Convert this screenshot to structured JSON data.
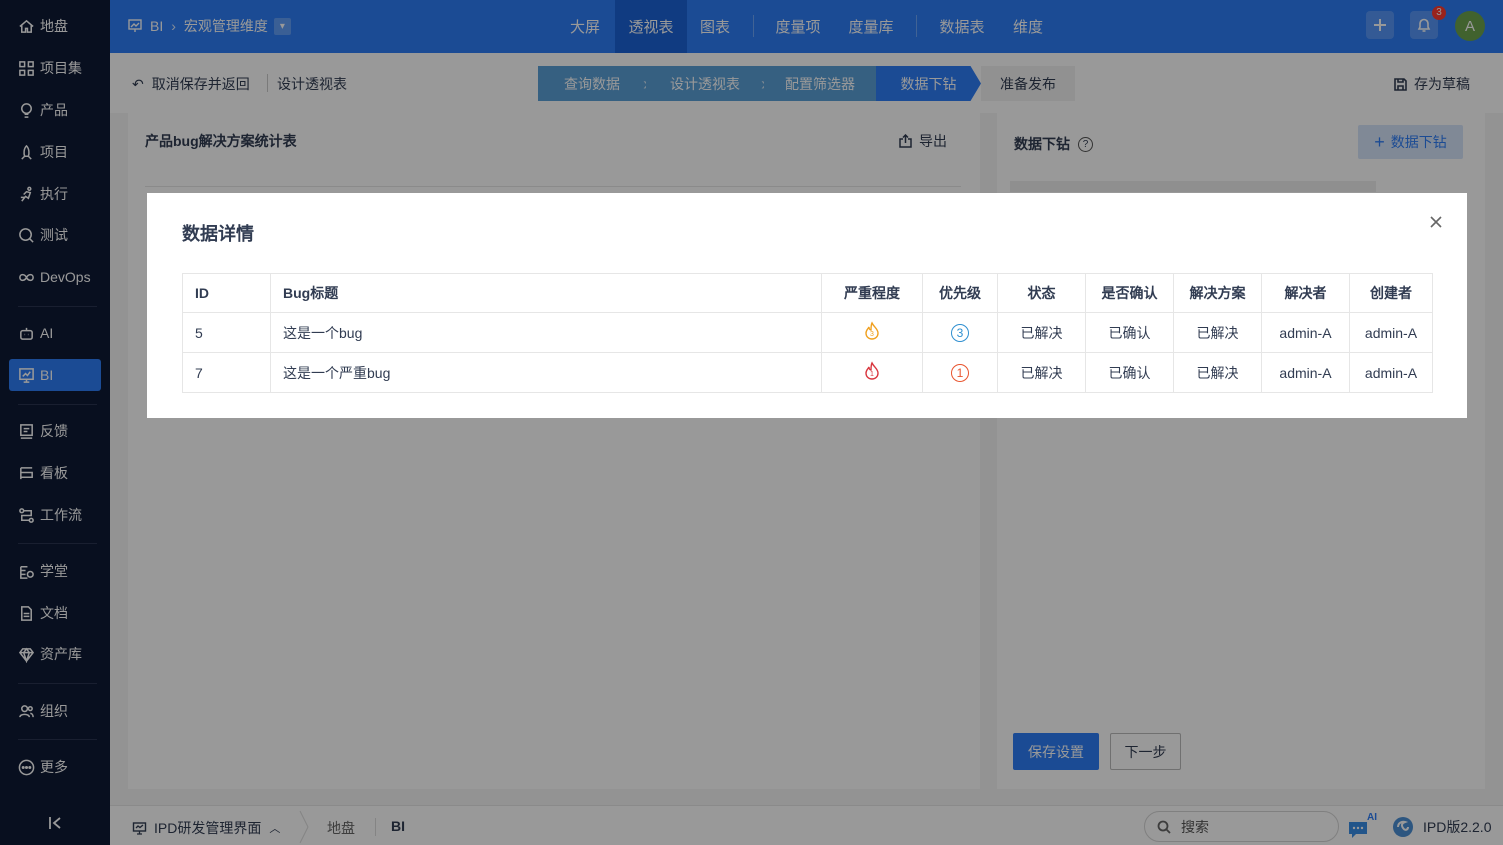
{
  "sidebar": {
    "items": [
      {
        "label": "地盘",
        "icon": "home-icon"
      },
      {
        "label": "项目集",
        "icon": "grid-icon"
      },
      {
        "label": "产品",
        "icon": "bulb-icon"
      },
      {
        "label": "项目",
        "icon": "rocket-icon"
      },
      {
        "label": "执行",
        "icon": "run-icon"
      },
      {
        "label": "测试",
        "icon": "magnifier-icon"
      },
      {
        "label": "DevOps",
        "icon": "infinity-icon"
      },
      {
        "label": "AI",
        "icon": "robot-icon"
      },
      {
        "label": "BI",
        "icon": "chart-board-icon"
      },
      {
        "label": "反馈",
        "icon": "feedback-icon"
      },
      {
        "label": "看板",
        "icon": "kanban-icon"
      },
      {
        "label": "工作流",
        "icon": "workflow-icon"
      },
      {
        "label": "学堂",
        "icon": "school-icon"
      },
      {
        "label": "文档",
        "icon": "document-icon"
      },
      {
        "label": "资产库",
        "icon": "diamond-icon"
      },
      {
        "label": "组织",
        "icon": "people-icon"
      },
      {
        "label": "更多",
        "icon": "more-icon"
      }
    ],
    "active": "BI"
  },
  "topbar": {
    "breadcrumb_root": "BI",
    "breadcrumb_current": "宏观管理维度",
    "nav": [
      "大屏",
      "透视表",
      "图表",
      "度量项",
      "度量库",
      "数据表",
      "维度"
    ],
    "active_nav": "透视表",
    "notification_count": "3",
    "avatar_letter": "A"
  },
  "subbar": {
    "back_label": "取消保存并返回",
    "design_label": "设计透视表",
    "steps": [
      "查询数据",
      "设计透视表",
      "配置筛选器",
      "数据下钻",
      "准备发布"
    ],
    "current_step": "数据下钻",
    "draft_label": "存为草稿"
  },
  "left_panel": {
    "title": "产品bug解决方案统计表",
    "export_label": "导出"
  },
  "right_panel": {
    "title": "数据下钻",
    "help": "?",
    "add_label": "数据下钻",
    "save_label": "保存设置",
    "next_label": "下一步"
  },
  "bottombar": {
    "menu_label": "IPD研发管理界面",
    "crumb1": "地盘",
    "crumb2": "BI",
    "search_placeholder": "搜索",
    "ai_badge": "AI",
    "version": "IPD版2.2.0"
  },
  "modal": {
    "title": "数据详情",
    "columns": [
      "ID",
      "Bug标题",
      "严重程度",
      "优先级",
      "状态",
      "是否确认",
      "解决方案",
      "解决者",
      "创建者"
    ],
    "rows": [
      {
        "id": "5",
        "title": "这是一个bug",
        "severity": "3",
        "priority": "3",
        "status": "已解决",
        "confirmed": "已确认",
        "resolution": "已解决",
        "resolver": "admin-A",
        "creator": "admin-A"
      },
      {
        "id": "7",
        "title": "这是一个严重bug",
        "severity": "1",
        "priority": "1",
        "status": "已解决",
        "confirmed": "已确认",
        "resolution": "已解决",
        "resolver": "admin-A",
        "creator": "admin-A"
      }
    ]
  },
  "colors": {
    "primary": "#2e7ef7",
    "sidebar_bg": "#0e1a35",
    "status_green": "#00b050",
    "severity3": "#f0a020",
    "severity1": "#d9363e",
    "priority3": "#2f8fd0",
    "priority1": "#e8542e"
  }
}
